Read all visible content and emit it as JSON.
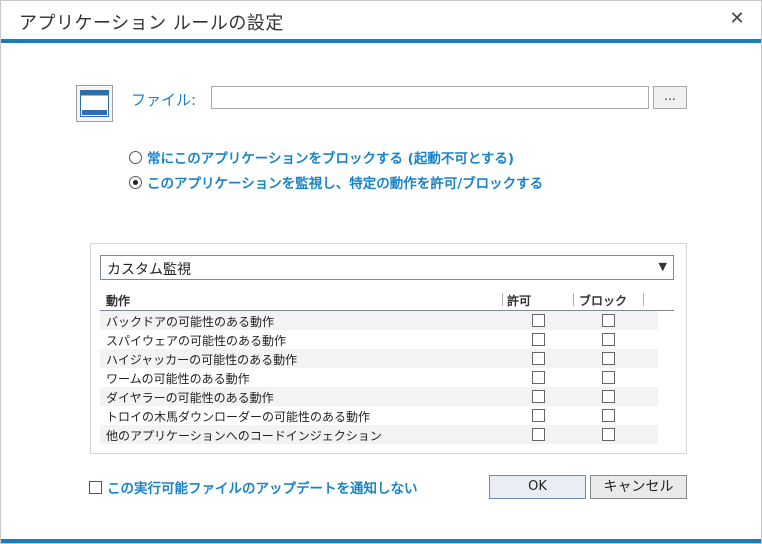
{
  "window": {
    "title": "アプリケーション ルールの設定",
    "close_symbol": "✕"
  },
  "file": {
    "label": "ファイル:",
    "value": "",
    "browse_label": "..."
  },
  "mode": {
    "options": [
      {
        "label": "常にこのアプリケーションをブロックする (起動不可とする)",
        "selected": false
      },
      {
        "label": "このアプリケーションを監視し、特定の動作を許可/ブロックする",
        "selected": true
      }
    ]
  },
  "monitor": {
    "preset": "カスタム監視",
    "columns": {
      "action": "動作",
      "allow": "許可",
      "block": "ブロック"
    },
    "rows": [
      {
        "label": "バックドアの可能性のある動作",
        "allow": false,
        "block": false
      },
      {
        "label": "スパイウェアの可能性のある動作",
        "allow": false,
        "block": false
      },
      {
        "label": "ハイジャッカーの可能性のある動作",
        "allow": false,
        "block": false
      },
      {
        "label": "ワームの可能性のある動作",
        "allow": false,
        "block": false
      },
      {
        "label": "ダイヤラーの可能性のある動作",
        "allow": false,
        "block": false
      },
      {
        "label": "トロイの木馬ダウンローダーの可能性のある動作",
        "allow": false,
        "block": false
      },
      {
        "label": "他のアプリケーションへのコードインジェクション",
        "allow": false,
        "block": false
      }
    ]
  },
  "notify": {
    "label": "この実行可能ファイルのアップデートを通知しない",
    "checked": false
  },
  "buttons": {
    "ok": "OK",
    "cancel": "キャンセル"
  },
  "colors": {
    "accent": "#1e7db8",
    "label_blue": "#1a84c7"
  },
  "icons": {
    "close": "close-icon",
    "app": "application-window-icon",
    "dropdown": "chevron-down-icon"
  }
}
